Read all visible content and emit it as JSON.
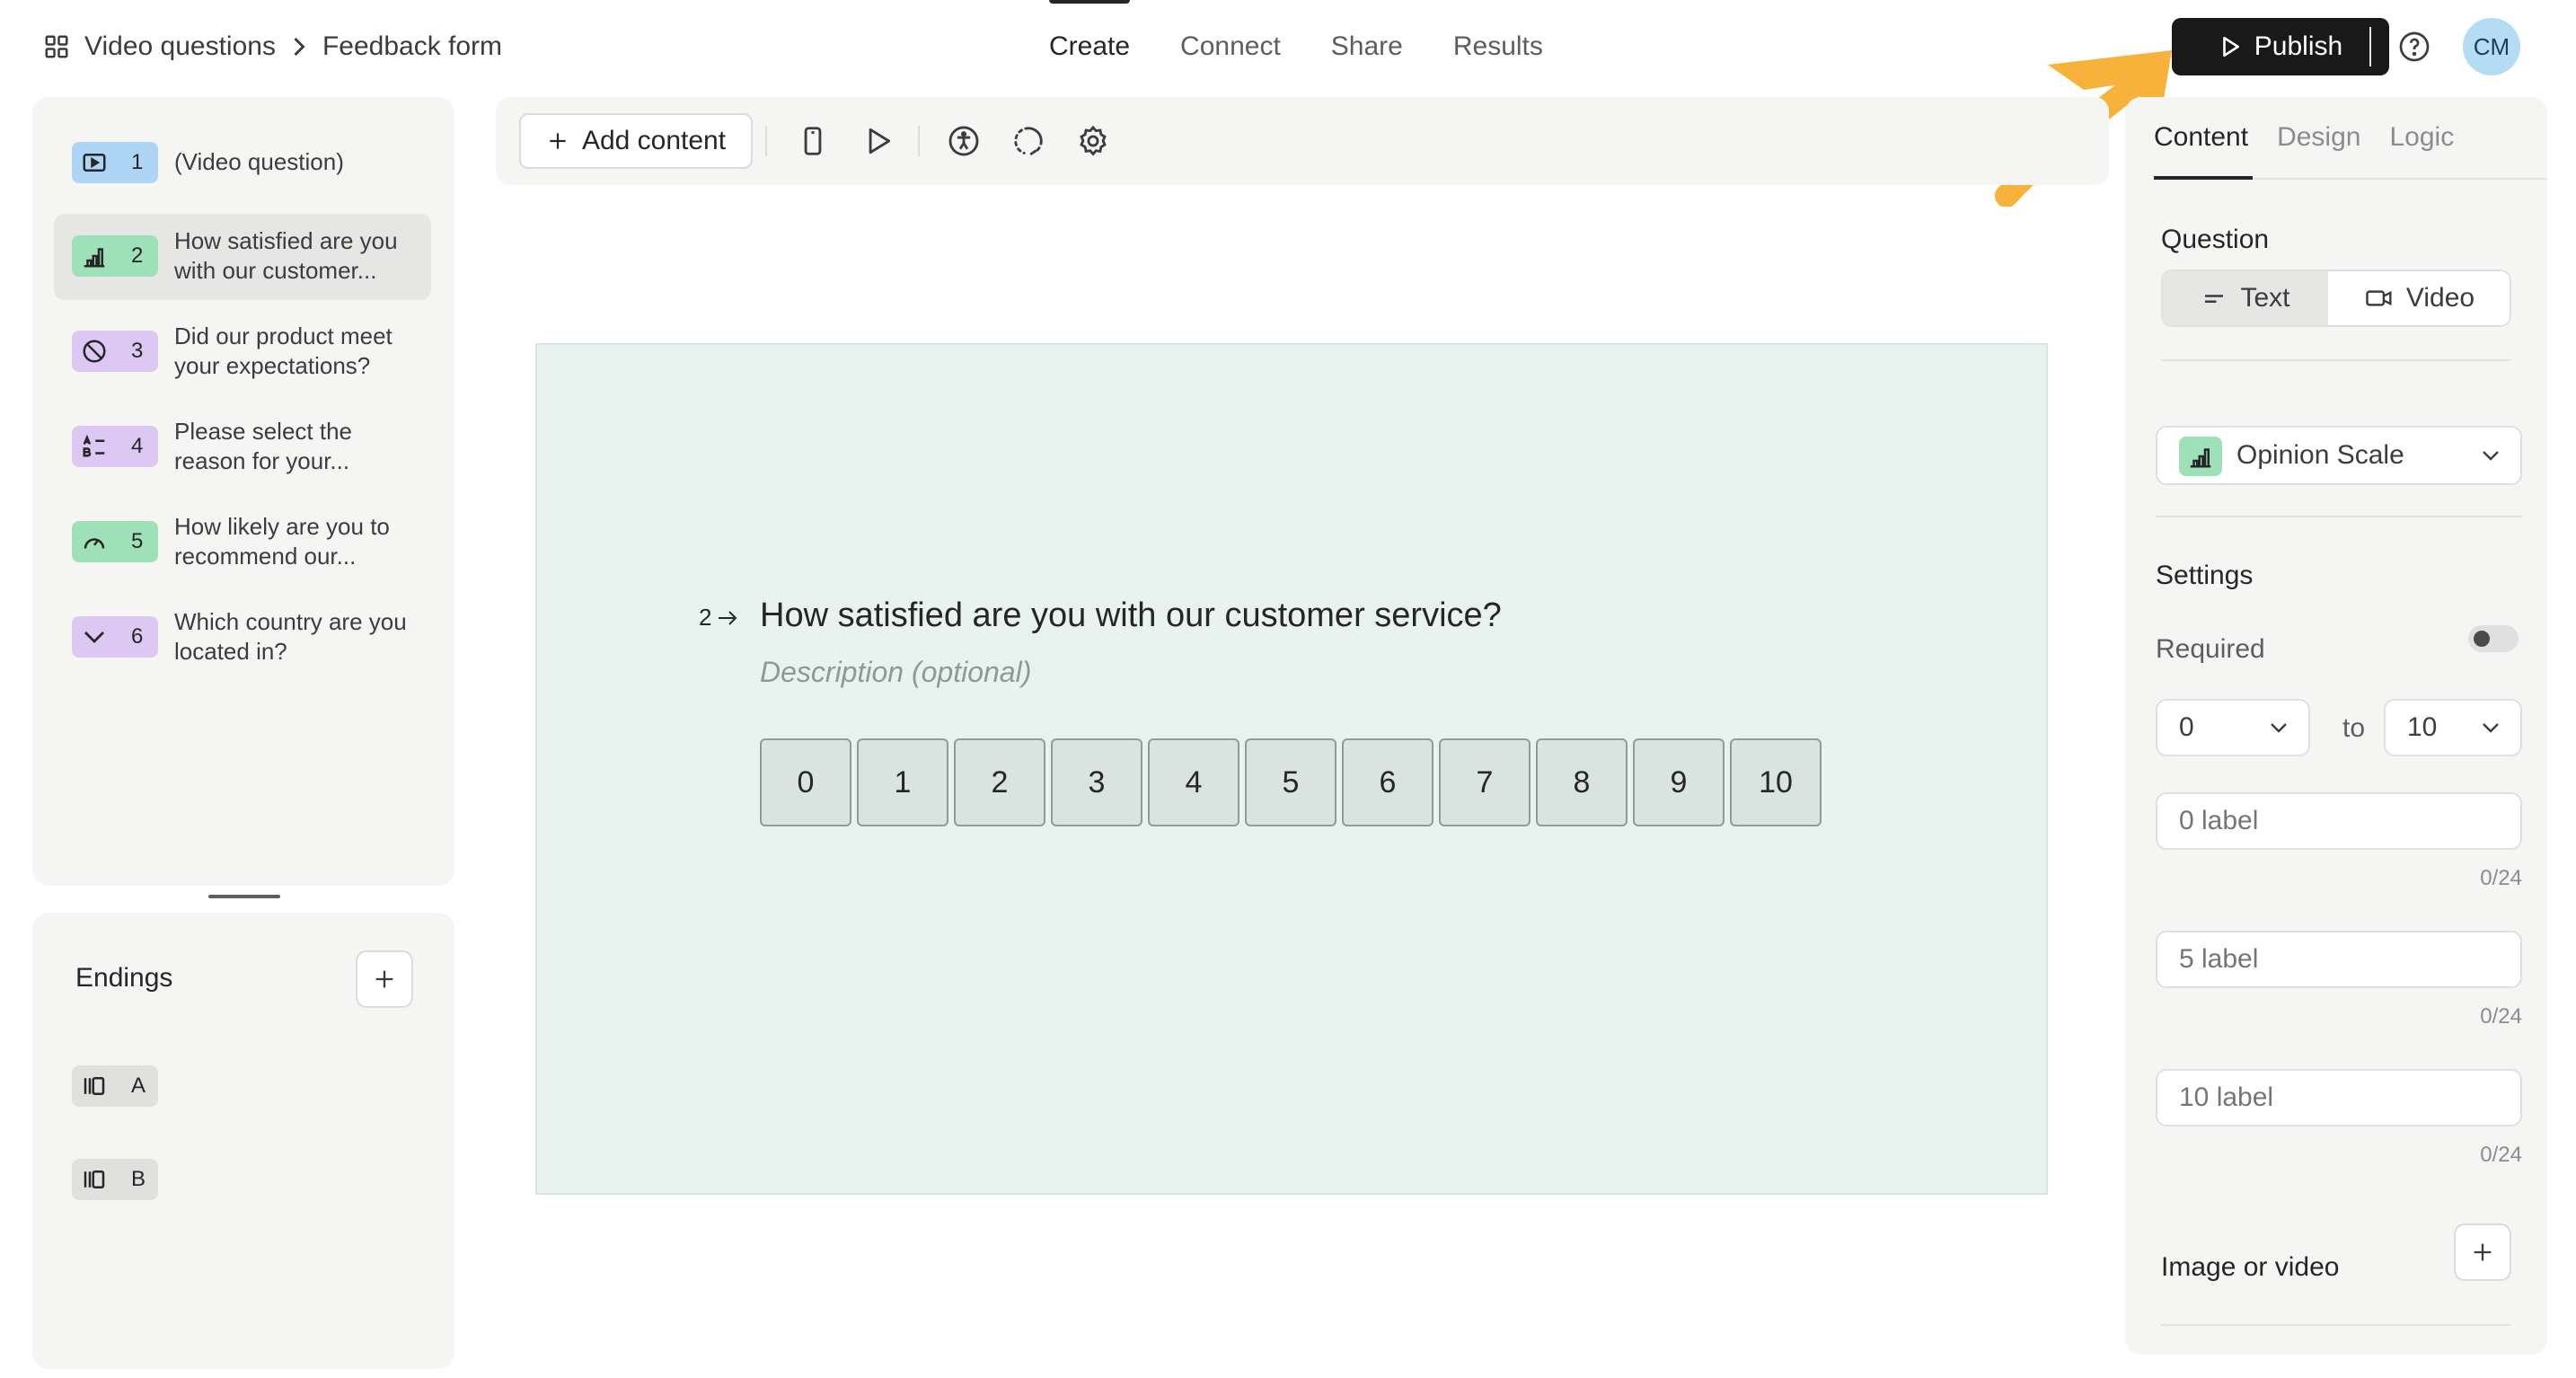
{
  "breadcrumb": {
    "workspace": "Video questions",
    "form": "Feedback form"
  },
  "topnav": {
    "tabs": [
      "Create",
      "Connect",
      "Share",
      "Results"
    ],
    "active": "Create"
  },
  "publish_label": "Publish",
  "avatar_initials": "CM",
  "questions": [
    {
      "num": "1",
      "text": "(Video question)",
      "icon": "video-icon",
      "color": "#aed6f4"
    },
    {
      "num": "2",
      "text": "How satisfied are you with our customer...",
      "icon": "opinion-scale-icon",
      "color": "#9ee0b8"
    },
    {
      "num": "3",
      "text": "Did our product meet your expectations?",
      "icon": "yes-no-icon",
      "color": "#ddc8f3"
    },
    {
      "num": "4",
      "text": "Please select the reason for your...",
      "icon": "multiple-choice-icon",
      "color": "#ddc8f3"
    },
    {
      "num": "5",
      "text": "How likely are you to recommend our...",
      "icon": "nps-gauge-icon",
      "color": "#9ee0b8"
    },
    {
      "num": "6",
      "text": "Which country are you located in?",
      "icon": "dropdown-icon",
      "color": "#ddc8f3"
    }
  ],
  "endings": {
    "title": "Endings",
    "items": [
      "A",
      "B"
    ]
  },
  "toolbar": {
    "add_content": "Add content"
  },
  "canvas": {
    "question_number": "2",
    "question": "How satisfied are you with our customer service?",
    "description_placeholder": "Description (optional)",
    "scale": [
      "0",
      "1",
      "2",
      "3",
      "4",
      "5",
      "6",
      "7",
      "8",
      "9",
      "10"
    ]
  },
  "panel": {
    "tabs": [
      "Content",
      "Design",
      "Logic"
    ],
    "active_tab": "Content",
    "question_label": "Question",
    "question_type_options": [
      "Text",
      "Video"
    ],
    "question_type_selected": "Text",
    "question_kind": "Opinion Scale",
    "settings_label": "Settings",
    "required_label": "Required",
    "required": false,
    "range_from": "0",
    "range_to_label": "to",
    "range_to": "10",
    "label_fields": [
      {
        "placeholder": "0 label",
        "counter": "0/24"
      },
      {
        "placeholder": "5 label",
        "counter": "0/24"
      },
      {
        "placeholder": "10 label",
        "counter": "0/24"
      }
    ],
    "image_or_video_label": "Image or video"
  },
  "colors": {
    "canvas_bg": "#e8f3f0",
    "publish_bg": "#191919",
    "annotation_arrow": "#f7b23b"
  }
}
